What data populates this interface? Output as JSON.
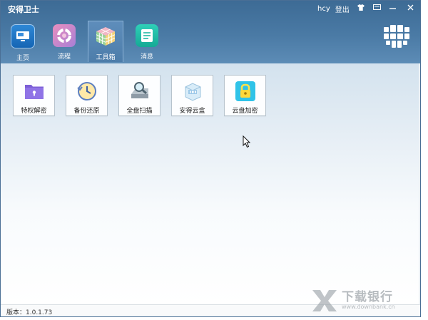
{
  "app": {
    "title": "安得卫士",
    "user": "hcy",
    "login_label": "登出"
  },
  "window_controls": {
    "shirt": "skin-icon",
    "msg": "message-icon",
    "minimize": "minimize-icon",
    "close": "close-icon"
  },
  "nav": {
    "items": [
      {
        "label": "主页",
        "icon": "home-monitor-icon"
      },
      {
        "label": "流程",
        "icon": "process-ring-icon"
      },
      {
        "label": "工具箱",
        "icon": "rubiks-cube-icon",
        "active": true
      },
      {
        "label": "消息",
        "icon": "document-icon"
      }
    ]
  },
  "tools": [
    {
      "label": "特权解密",
      "icon": "purple-folder-lock-icon"
    },
    {
      "label": "备份还原",
      "icon": "backup-clock-icon"
    },
    {
      "label": "全盘扫描",
      "icon": "disk-scan-magnifier-icon"
    },
    {
      "label": "安得云盒",
      "icon": "ias-cloud-box-icon"
    },
    {
      "label": "云盘加密",
      "icon": "cloud-lock-icon"
    }
  ],
  "footer": {
    "version": "版本：1.0.1.73"
  },
  "watermark": {
    "title": "下载银行",
    "url": "www.downbank.cn"
  },
  "colors": {
    "header": "#4a7aa5",
    "content_top": "#d3e2ee",
    "accent": "#4e88c3"
  }
}
